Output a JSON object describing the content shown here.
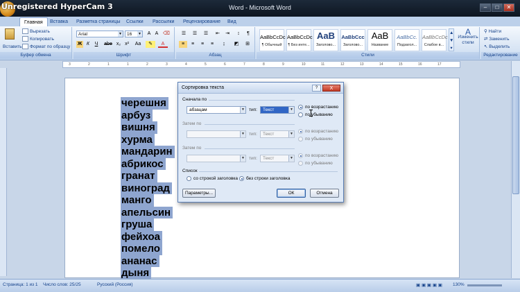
{
  "window": {
    "watermark": "Unregistered HyperCam 3",
    "title": "Word - Microsoft Word"
  },
  "tabs": [
    "Главная",
    "Вставка",
    "Разметка страницы",
    "Ссылки",
    "Рассылки",
    "Рецензирование",
    "Вид"
  ],
  "ribbon": {
    "clipboard": {
      "paste": "Вставить",
      "cut": "Вырезать",
      "copy": "Копировать",
      "format_painter": "Формат по образцу",
      "label": "Буфер обмена"
    },
    "font": {
      "name": "Arial",
      "size": "16",
      "label": "Шрифт",
      "buttons": [
        "Ж",
        "К",
        "Ч",
        "abe",
        "x₂",
        "x²",
        "Aa",
        "A"
      ]
    },
    "paragraph": {
      "label": "Абзац"
    },
    "styles": {
      "label": "Стили",
      "items": [
        {
          "sample": "AaBbCcDc",
          "name": "¶ Обычный"
        },
        {
          "sample": "AaBbCcDc",
          "name": "¶ Без инте..."
        },
        {
          "sample": "AaB",
          "name": "Заголово..."
        },
        {
          "sample": "AaBbCcc",
          "name": "Заголово..."
        },
        {
          "sample": "AaB",
          "name": "Название"
        },
        {
          "sample": "AaBbCc.",
          "name": "Подзагол..."
        },
        {
          "sample": "AaBbCcDc",
          "name": "Слабое в..."
        }
      ],
      "change_styles": "Изменить стили"
    },
    "editing": {
      "find": "Найти",
      "replace": "Заменить",
      "select": "Выделить",
      "label": "Редактирование"
    }
  },
  "ruler_ticks": [
    "3",
    "2",
    "1",
    "1",
    "2",
    "3",
    "4",
    "5",
    "6",
    "7",
    "8",
    "9",
    "10",
    "11",
    "12",
    "13",
    "14",
    "15",
    "16",
    "17"
  ],
  "document": {
    "words": [
      "черешня",
      "арбуз",
      "вишня",
      "хурма",
      "мандарин",
      "абрикос",
      "гранат",
      "виноград",
      "манго",
      "апельсин",
      "груша",
      "фейхоа",
      "помело",
      "ананас",
      "дыня"
    ]
  },
  "dialog": {
    "title": "Сортировка текста",
    "help": "?",
    "close": "X",
    "first_by_label": "Сначала по",
    "first_by_value": "абзацам",
    "type_label": "тип:",
    "type_value": "Текст",
    "then_by_label_1": "Затем по",
    "then_by_label_2": "Затем по",
    "ascending": "по возрастанию",
    "descending": "по убыванию",
    "list_label": "Список",
    "with_header": "со строкой заголовка",
    "without_header": "без строки заголовка",
    "params_button": "Параметры...",
    "ok_button": "ОК",
    "cancel_button": "Отмена"
  },
  "status": {
    "page": "Страница: 1 из 1",
    "words": "Число слов: 25/25",
    "language": "Русский (Россия)",
    "zoom": "130%"
  }
}
